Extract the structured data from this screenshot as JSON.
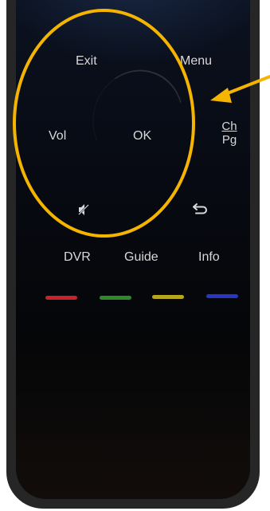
{
  "remote": {
    "buttons": {
      "exit": "Exit",
      "menu": "Menu",
      "vol": "Vol",
      "ok": "OK",
      "ch": "Ch",
      "pg": "Pg",
      "dvr": "DVR",
      "guide": "Guide",
      "info": "Info"
    },
    "icons": [
      "mute-icon",
      "back-icon"
    ],
    "color_keys": [
      {
        "name": "red",
        "color": "#c8232a"
      },
      {
        "name": "green",
        "color": "#2c8a2a"
      },
      {
        "name": "yellow",
        "color": "#b7a51f"
      },
      {
        "name": "blue",
        "color": "#2836c4"
      }
    ]
  },
  "annotation": {
    "color": "#f5b400"
  }
}
